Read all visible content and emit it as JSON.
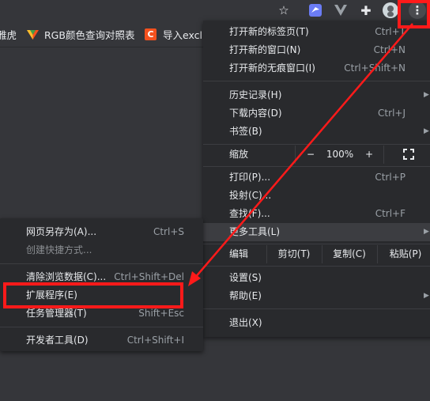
{
  "toolbar": {
    "icons": [
      "star-icon",
      "bird-extension-icon",
      "vue-extension-icon",
      "puzzle-extensions-icon",
      "profile-avatar",
      "kebab-menu-icon"
    ],
    "star_glyph": "☆",
    "puzzle_glyph": "✚",
    "kebab_glyph": "⋮"
  },
  "bookmarks": [
    {
      "label": "雅虎",
      "favicon": "none"
    },
    {
      "label": "RGB颜色查询对照表",
      "favicon": "colorful-v-icon"
    },
    {
      "label": "导入excl",
      "favicon": "c-logo-icon",
      "icon_letter": "C"
    }
  ],
  "menu": {
    "new_tab": {
      "label": "打开新的标签页(T)",
      "shortcut": "Ctrl+T"
    },
    "new_window": {
      "label": "打开新的窗口(N)",
      "shortcut": "Ctrl+N"
    },
    "incognito": {
      "label": "打开新的无痕窗口(I)",
      "shortcut": "Ctrl+Shift+N"
    },
    "history": {
      "label": "历史记录(H)"
    },
    "downloads": {
      "label": "下载内容(D)",
      "shortcut": "Ctrl+J"
    },
    "bookmarks": {
      "label": "书签(B)"
    },
    "zoom": {
      "label": "缩放",
      "minus": "−",
      "value": "100%",
      "plus": "+"
    },
    "print": {
      "label": "打印(P)...",
      "shortcut": "Ctrl+P"
    },
    "cast": {
      "label": "投射(C)..."
    },
    "find": {
      "label": "查找(F)...",
      "shortcut": "Ctrl+F"
    },
    "more_tools": {
      "label": "更多工具(L)"
    },
    "edit": {
      "label": "编辑",
      "cut": "剪切(T)",
      "copy": "复制(C)",
      "paste": "粘贴(P)"
    },
    "settings": {
      "label": "设置(S)"
    },
    "help": {
      "label": "帮助(E)"
    },
    "exit": {
      "label": "退出(X)"
    }
  },
  "submenu": {
    "save_page": {
      "label": "网页另存为(A)...",
      "shortcut": "Ctrl+S"
    },
    "create_shortcut": {
      "label": "创建快捷方式..."
    },
    "clear_data": {
      "label": "清除浏览数据(C)...",
      "shortcut": "Ctrl+Shift+Del"
    },
    "extensions": {
      "label": "扩展程序(E)"
    },
    "task_manager": {
      "label": "任务管理器(T)",
      "shortcut": "Shift+Esc"
    },
    "devtools": {
      "label": "开发者工具(D)",
      "shortcut": "Ctrl+Shift+I"
    }
  },
  "colors": {
    "annotation": "#ff1a1a",
    "menu_bg": "#292a2d",
    "page_bg": "#35363a",
    "highlight": "#3c3d41"
  }
}
